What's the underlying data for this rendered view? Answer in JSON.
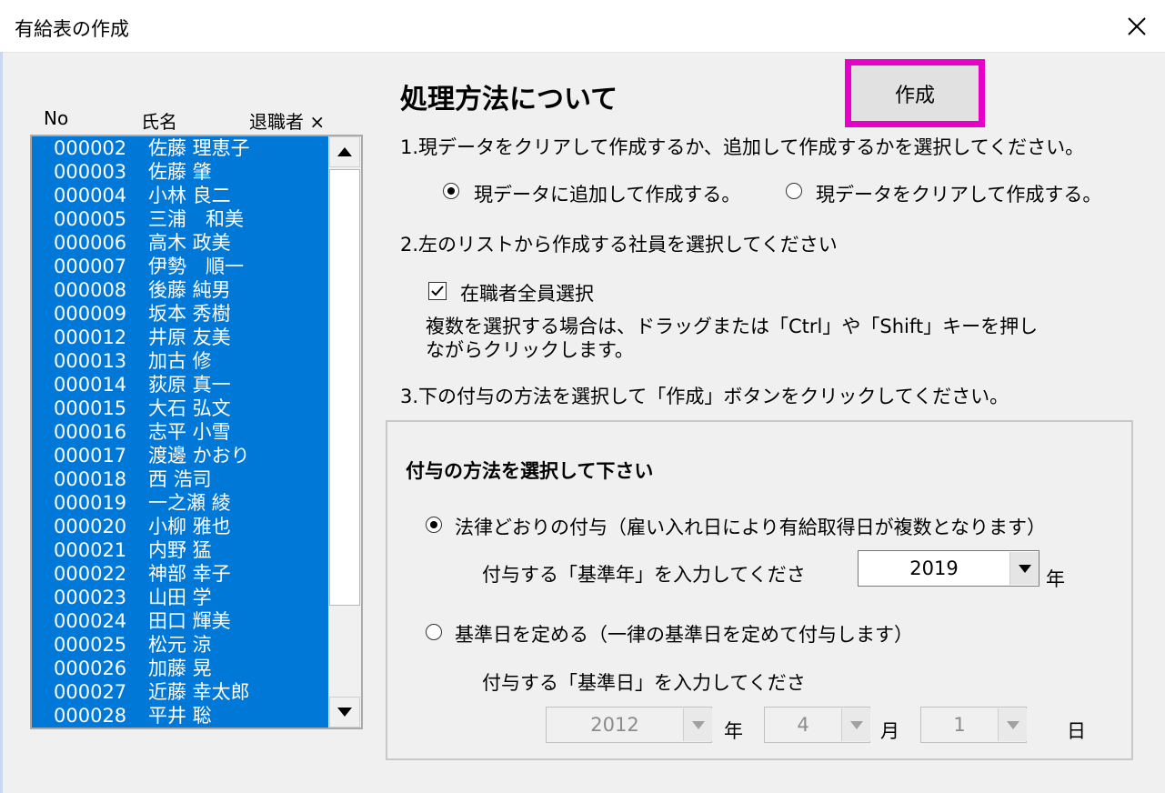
{
  "window": {
    "title": "有給表の作成"
  },
  "list": {
    "headers": {
      "no": "No",
      "name": "氏名",
      "retired": "退職者 ×"
    },
    "rows": [
      {
        "no": "000002",
        "name": "佐藤 理恵子"
      },
      {
        "no": "000003",
        "name": "佐藤 肇"
      },
      {
        "no": "000004",
        "name": "小林 良二"
      },
      {
        "no": "000005",
        "name": "三浦　和美"
      },
      {
        "no": "000006",
        "name": "高木 政美"
      },
      {
        "no": "000007",
        "name": "伊勢　順一"
      },
      {
        "no": "000008",
        "name": "後藤 純男"
      },
      {
        "no": "000009",
        "name": "坂本 秀樹"
      },
      {
        "no": "000012",
        "name": "井原 友美"
      },
      {
        "no": "000013",
        "name": "加古 修"
      },
      {
        "no": "000014",
        "name": "荻原 真一"
      },
      {
        "no": "000015",
        "name": "大石 弘文"
      },
      {
        "no": "000016",
        "name": "志平 小雪"
      },
      {
        "no": "000017",
        "name": "渡邊 かおり"
      },
      {
        "no": "000018",
        "name": "西 浩司"
      },
      {
        "no": "000019",
        "name": "一之瀬 綾"
      },
      {
        "no": "000020",
        "name": "小柳 雅也"
      },
      {
        "no": "000021",
        "name": "内野 猛"
      },
      {
        "no": "000022",
        "name": "神部 幸子"
      },
      {
        "no": "000023",
        "name": "山田 学"
      },
      {
        "no": "000024",
        "name": "田口 輝美"
      },
      {
        "no": "000025",
        "name": "松元 涼"
      },
      {
        "no": "000026",
        "name": "加藤 晃"
      },
      {
        "no": "000027",
        "name": "近藤 幸太郎"
      },
      {
        "no": "000028",
        "name": "平井 聡"
      }
    ]
  },
  "panel": {
    "heading": "処理方法について",
    "create_button": "作成",
    "step1": "1.現データをクリアして作成するか、追加して作成するかを選択してください。",
    "option_add": "現データに追加して作成する。",
    "option_clear": "現データをクリアして作成する。",
    "step2": "2.左のリストから作成する社員を選択してください",
    "select_all_label": "在職者全員選択",
    "note_line1": "複数を選択する場合は、ドラッグまたは「Ctrl」や「Shift」キーを押し",
    "note_line2": "ながらクリックします。",
    "step3": "3.下の付与の方法を選択して「作成」ボタンをクリックしてください。"
  },
  "grant": {
    "title": "付与の方法を選択して下さい",
    "option_law": "法律どおりの付与（雇い入れ日により有給取得日が複数となります）",
    "base_year_label": "付与する「基準年」を入力してくださ",
    "base_year_value": "2019",
    "year_unit": "年",
    "option_fixed": "基準日を定める（一律の基準日を定めて付与します）",
    "base_date_label": "付与する「基準日」を入力してくださ",
    "date_year": "2012",
    "date_month": "4",
    "date_day": "1",
    "month_unit": "月",
    "day_unit": "日"
  },
  "colors": {
    "selection": "#0078d7",
    "highlight_border": "#e600c8"
  }
}
